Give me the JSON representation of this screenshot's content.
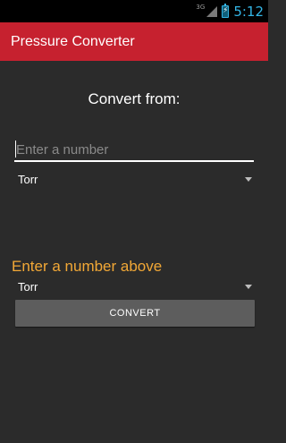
{
  "status_bar": {
    "network": "3G",
    "time": "5:12",
    "icons": [
      "signal-icon",
      "battery-icon"
    ]
  },
  "app": {
    "title": "Pressure Converter"
  },
  "form": {
    "heading": "Convert from:",
    "input_value": "",
    "input_placeholder": "Enter a number",
    "from_unit": "Torr",
    "result_text": "Enter a number above",
    "to_unit": "Torr",
    "convert_label": "CONVERT"
  },
  "colors": {
    "action_bar": "#c6212f",
    "background": "#2b2b2b",
    "result_text": "#f2a836",
    "clock": "#33b5e5",
    "button": "#5d5d5d"
  }
}
